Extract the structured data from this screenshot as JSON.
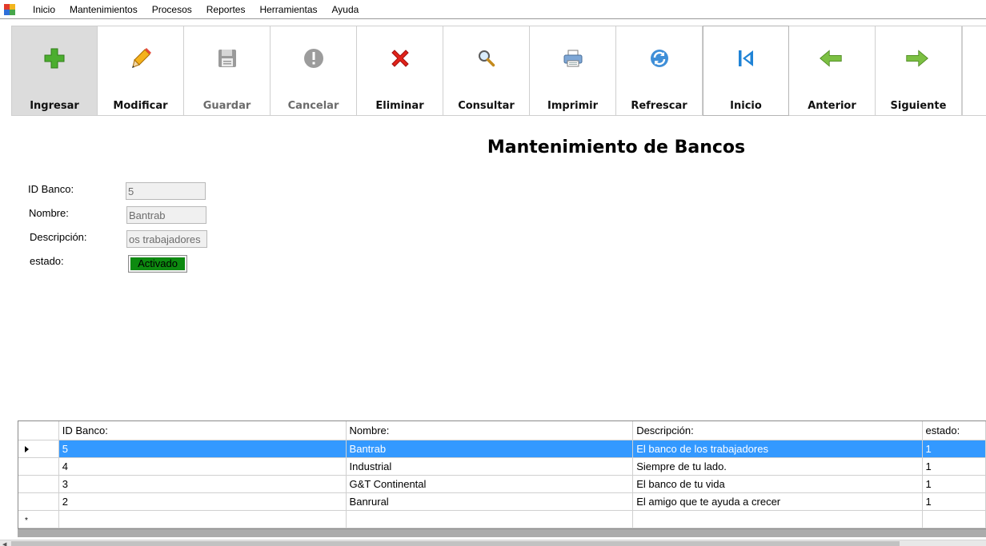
{
  "menu": {
    "items": [
      "Inicio",
      "Mantenimientos",
      "Procesos",
      "Reportes",
      "Herramientas",
      "Ayuda"
    ]
  },
  "toolbar": {
    "buttons": [
      {
        "label": "Ingresar",
        "icon": "plus-icon"
      },
      {
        "label": "Modificar",
        "icon": "pencil-icon"
      },
      {
        "label": "Guardar",
        "icon": "floppy-disk-icon"
      },
      {
        "label": "Cancelar",
        "icon": "exclamation-icon"
      },
      {
        "label": "Eliminar",
        "icon": "red-x-icon"
      },
      {
        "label": "Consultar",
        "icon": "magnifier-icon"
      },
      {
        "label": "Imprimir",
        "icon": "printer-icon"
      },
      {
        "label": "Refrescar",
        "icon": "refresh-icon"
      },
      {
        "label": "Inicio",
        "icon": "skip-first-icon"
      },
      {
        "label": "Anterior",
        "icon": "arrow-left-icon"
      },
      {
        "label": "Siguiente",
        "icon": "arrow-right-icon"
      }
    ]
  },
  "title": "Mantenimiento de Bancos",
  "form": {
    "id_label": "ID Banco:",
    "id_value": "5",
    "nombre_label": "Nombre:",
    "nombre_value": "Bantrab",
    "descripcion_label": "Descripción:",
    "descripcion_value": "os trabajadores",
    "estado_label": "estado:",
    "estado_value": "Activado"
  },
  "grid": {
    "columns": [
      "ID Banco:",
      "Nombre:",
      "Descripción:",
      "estado:"
    ],
    "rows": [
      [
        "5",
        "Bantrab",
        "El banco de los trabajadores",
        "1"
      ],
      [
        "4",
        "Industrial",
        "Siempre de tu lado.",
        "1"
      ],
      [
        "3",
        "G&T Continental",
        "El banco de tu vida",
        "1"
      ],
      [
        "2",
        "Banrural",
        "El amigo que te ayuda a crecer",
        "1"
      ]
    ],
    "new_row_marker": "*"
  },
  "colors": {
    "selection": "#3399ff",
    "status_active": "#0d8a10"
  }
}
